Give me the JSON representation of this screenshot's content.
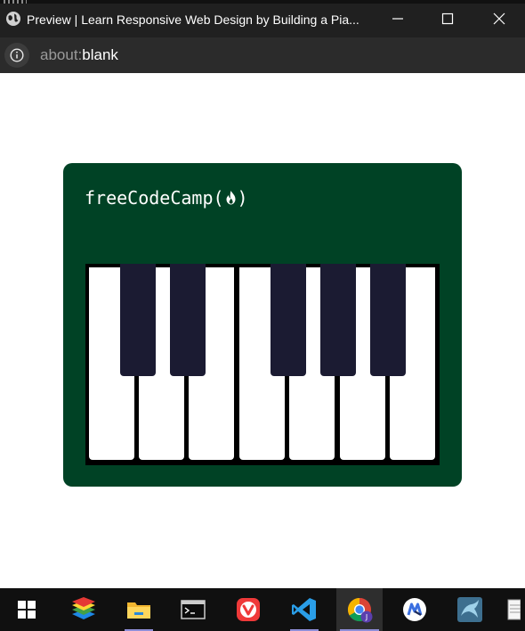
{
  "window": {
    "title": "Preview | Learn Responsive Web Design by Building a Pia...",
    "icon": "globe-icon",
    "controls": [
      "minimize-icon",
      "maximize-icon",
      "close-icon"
    ]
  },
  "address_bar": {
    "info_icon": "info-icon",
    "url_scheme": "about:",
    "url_path": "blank"
  },
  "page": {
    "logo_text_prefix": "freeCodeCamp(",
    "logo_text_suffix": ")",
    "logo_icon": "flame-icon",
    "colors": {
      "piano_background": "#004225",
      "key_frame": "#000000",
      "white_key": "#ffffff",
      "black_key": "#1b1b32"
    },
    "white_key_count": 7,
    "black_key_count": 5
  },
  "taskbar": {
    "items": [
      {
        "name": "start-button",
        "icon": "windows-logo-icon"
      },
      {
        "name": "taskbar-app-layers",
        "icon": "layers-app-icon"
      },
      {
        "name": "taskbar-app-file-explorer",
        "icon": "folder-icon"
      },
      {
        "name": "taskbar-app-terminal",
        "icon": "terminal-icon"
      },
      {
        "name": "taskbar-app-vivaldi",
        "icon": "vivaldi-icon"
      },
      {
        "name": "taskbar-app-vscode",
        "icon": "vscode-icon"
      },
      {
        "name": "taskbar-app-chrome",
        "icon": "chrome-icon",
        "badge": "J",
        "active": true
      },
      {
        "name": "taskbar-app-motrix",
        "icon": "motrix-icon"
      },
      {
        "name": "taskbar-app-mysql",
        "icon": "mysql-dolphin-icon"
      },
      {
        "name": "taskbar-app-notepad",
        "icon": "notepad-icon"
      }
    ]
  }
}
